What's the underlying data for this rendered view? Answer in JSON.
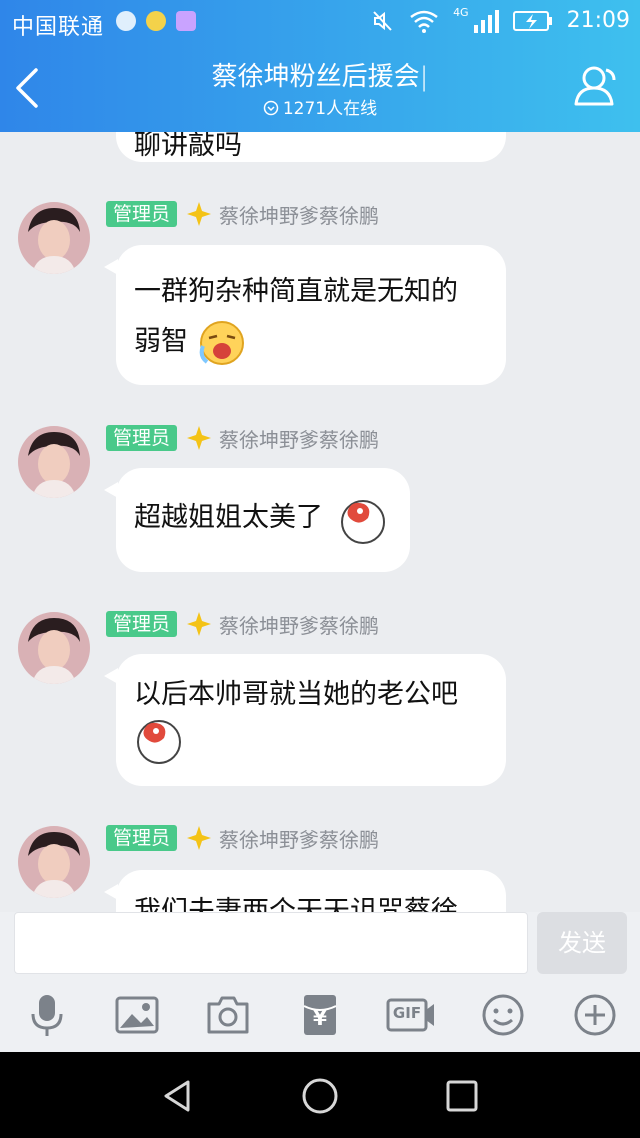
{
  "status_bar": {
    "carrier": "中国联通",
    "network": "4G",
    "time": "21:09"
  },
  "header": {
    "title": "蔡徐坤粉丝后援会",
    "online": "1271人在线"
  },
  "messages": [
    {
      "role": "管理员",
      "name": "蔡徐坤野爹蔡徐鹏",
      "text_line1": "一群狗杂种简直就是无知的",
      "text_line2": "弱智",
      "emoji": "crying-laughing-emoji"
    },
    {
      "role": "管理员",
      "name": "蔡徐坤野爹蔡徐鹏",
      "text": "超越姐姐太美了",
      "emoji": "sticker-face-emoji"
    },
    {
      "role": "管理员",
      "name": "蔡徐坤野爹蔡徐鹏",
      "text": "以后本帅哥就当她的老公吧",
      "emoji": "sticker-face-emoji"
    },
    {
      "role": "管理员",
      "name": "蔡徐坤野爹蔡徐鹏",
      "text": "我们夫妻两个天天诅咒蔡徐"
    }
  ],
  "top_partial_text": "聊讲敲吗",
  "composer": {
    "send_label": "发送",
    "placeholder": ""
  },
  "toolbar": {
    "gif_label": "GIF",
    "redpacket_label": "¥"
  },
  "colors": {
    "header_start": "#2f86e9",
    "header_end": "#3ec0ee",
    "badge": "#49c98a"
  }
}
